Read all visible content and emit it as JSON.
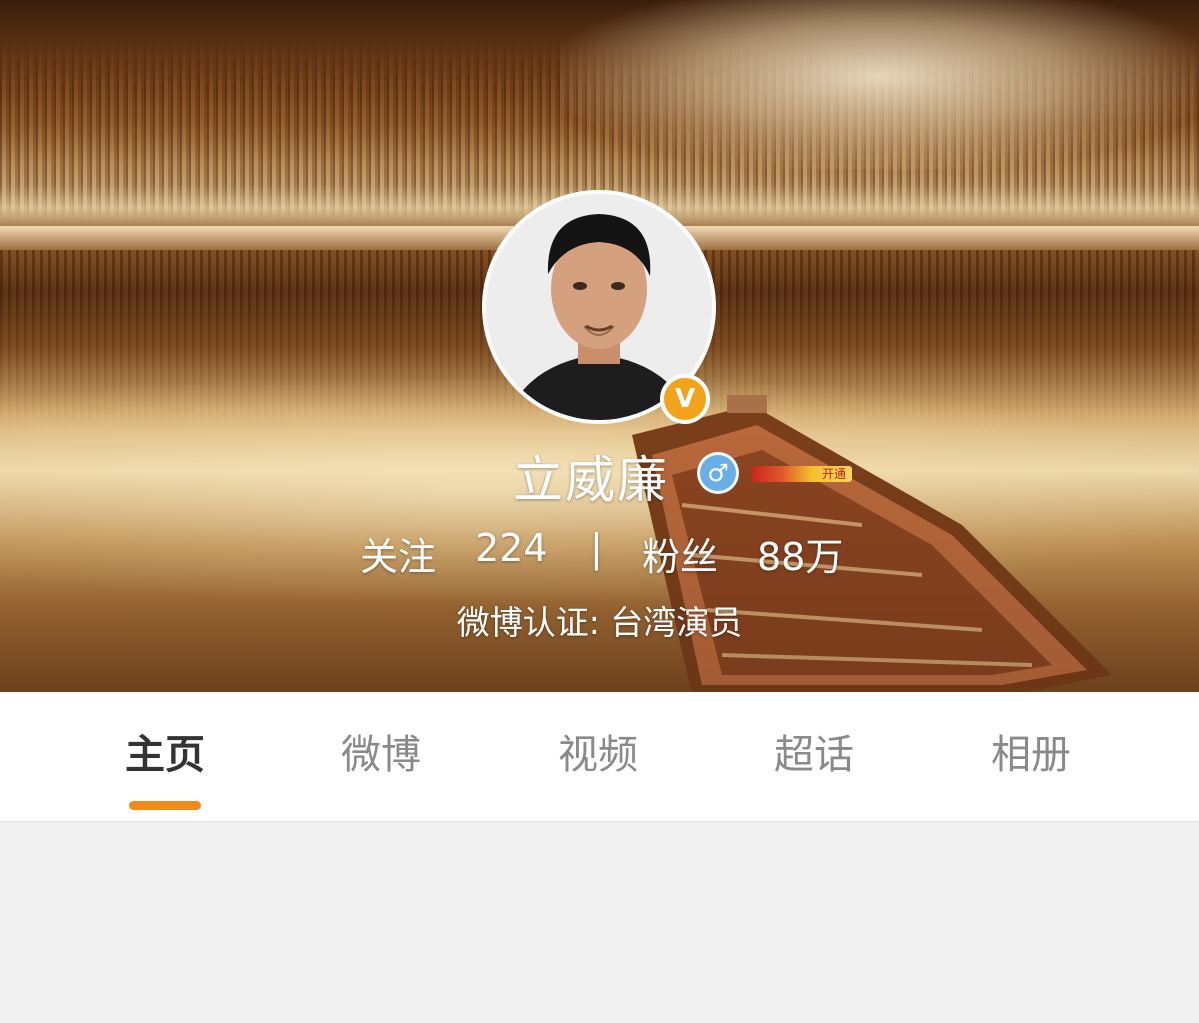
{
  "profile": {
    "name": "立威廉",
    "gender_icon": "male-icon",
    "gender_symbol": "♂",
    "verified_symbol": "V",
    "member_badge_text": "开通",
    "following_label": "关注",
    "following_count": "224",
    "divider": "|",
    "fans_label": "粉丝",
    "fans_count": "88万",
    "verification": "微博认证: 台湾演员"
  },
  "tabs": [
    {
      "label": "主页",
      "active": true
    },
    {
      "label": "微博",
      "active": false
    },
    {
      "label": "视频",
      "active": false
    },
    {
      "label": "超话",
      "active": false
    },
    {
      "label": "相册",
      "active": false
    }
  ],
  "colors": {
    "accent": "#f08a1a",
    "verified_badge": "#f2a31c",
    "gender_badge": "#6aaee8",
    "active_tab_text": "#333333",
    "inactive_tab_text": "#8a8a8a",
    "page_background": "#f0f0f0"
  }
}
